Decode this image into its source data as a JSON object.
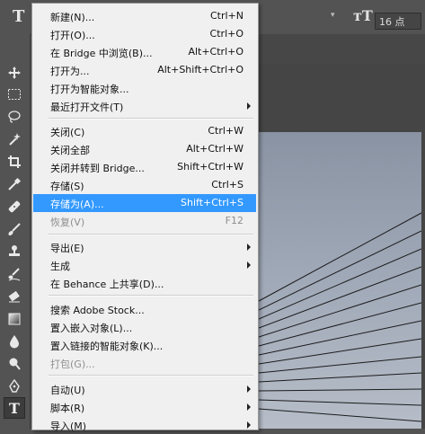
{
  "options_bar": {
    "font_size_value": "16 点"
  },
  "toolbar": {
    "tools": [
      "move-tool",
      "marquee-tool",
      "lasso-tool",
      "quick-select-tool",
      "crop-tool",
      "eyedropper-tool",
      "healing-brush-tool",
      "brush-tool",
      "clone-stamp-tool",
      "history-brush-tool",
      "eraser-tool",
      "gradient-tool",
      "blur-tool",
      "dodge-tool",
      "pen-tool",
      "type-tool"
    ]
  },
  "file_menu": {
    "items": [
      {
        "label": "新建(N)...",
        "shortcut": "Ctrl+N"
      },
      {
        "label": "打开(O)...",
        "shortcut": "Ctrl+O"
      },
      {
        "label": "在 Bridge 中浏览(B)...",
        "shortcut": "Alt+Ctrl+O"
      },
      {
        "label": "打开为...",
        "shortcut": "Alt+Shift+Ctrl+O"
      },
      {
        "label": "打开为智能对象...",
        "shortcut": ""
      },
      {
        "label": "最近打开文件(T)",
        "shortcut": ""
      },
      {
        "label": "关闭(C)",
        "shortcut": "Ctrl+W"
      },
      {
        "label": "关闭全部",
        "shortcut": "Alt+Ctrl+W"
      },
      {
        "label": "关闭并转到 Bridge...",
        "shortcut": "Shift+Ctrl+W"
      },
      {
        "label": "存储(S)",
        "shortcut": "Ctrl+S"
      },
      {
        "label": "存储为(A)...",
        "shortcut": "Shift+Ctrl+S"
      },
      {
        "label": "恢复(V)",
        "shortcut": "F12"
      },
      {
        "label": "导出(E)",
        "shortcut": ""
      },
      {
        "label": "生成",
        "shortcut": ""
      },
      {
        "label": "在 Behance 上共享(D)...",
        "shortcut": ""
      },
      {
        "label": "搜索 Adobe Stock...",
        "shortcut": ""
      },
      {
        "label": "置入嵌入对象(L)...",
        "shortcut": ""
      },
      {
        "label": "置入链接的智能对象(K)...",
        "shortcut": ""
      },
      {
        "label": "打包(G)...",
        "shortcut": ""
      },
      {
        "label": "自动(U)",
        "shortcut": ""
      },
      {
        "label": "脚本(R)",
        "shortcut": ""
      },
      {
        "label": "导入(M)",
        "shortcut": ""
      }
    ],
    "highlighted_item": "存储为(A)...",
    "highlight_color": "#3399ff"
  }
}
